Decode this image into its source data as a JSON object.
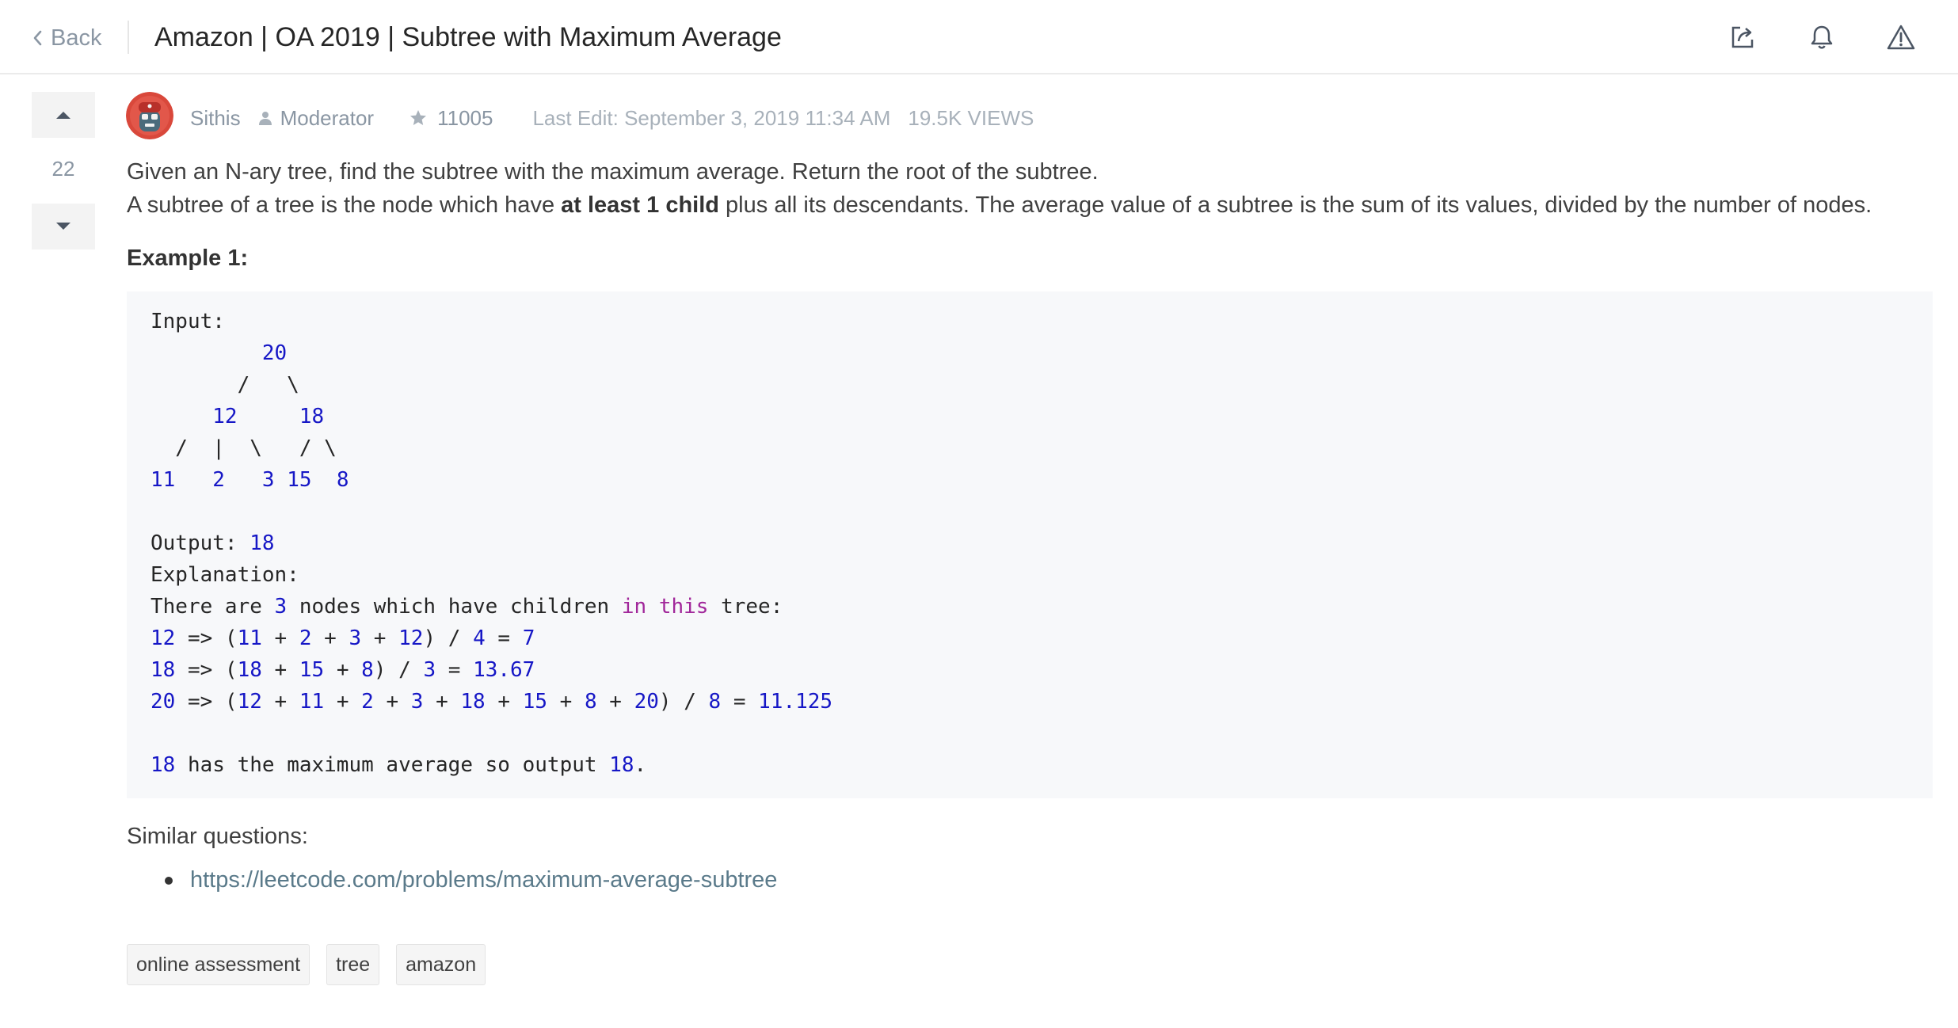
{
  "header": {
    "back_label": "Back",
    "title": "Amazon | OA 2019 | Subtree with Maximum Average",
    "icons": [
      "share-icon",
      "bell-icon",
      "warning-icon"
    ]
  },
  "vote": {
    "count": "22"
  },
  "author": {
    "username": "Sithis",
    "role": "Moderator",
    "reputation": "11005",
    "last_edit": "Last Edit: September 3, 2019 11:34 AM",
    "views": "19.5K VIEWS"
  },
  "post": {
    "line1": "Given an N-ary tree, find the subtree with the maximum average. Return the root of the subtree.",
    "line2_pre": "A subtree of a tree is the node which have ",
    "line2_bold": "at least 1 child",
    "line2_post": " plus all its descendants. The average value of a subtree is the sum of its values, divided by the number of nodes.",
    "example_heading": "Example 1:",
    "code_lines": [
      [
        {
          "t": "Input:"
        }
      ],
      [
        {
          "t": "         "
        },
        {
          "t": "20",
          "c": "num"
        }
      ],
      [
        {
          "t": "       /   \\"
        }
      ],
      [
        {
          "t": "     "
        },
        {
          "t": "12",
          "c": "num"
        },
        {
          "t": "     "
        },
        {
          "t": "18",
          "c": "num"
        }
      ],
      [
        {
          "t": "  /  |  \\   / \\"
        }
      ],
      [
        {
          "t": "11",
          "c": "num"
        },
        {
          "t": "   "
        },
        {
          "t": "2",
          "c": "num"
        },
        {
          "t": "   "
        },
        {
          "t": "3",
          "c": "num"
        },
        {
          "t": " "
        },
        {
          "t": "15",
          "c": "num"
        },
        {
          "t": "  "
        },
        {
          "t": "8",
          "c": "num"
        }
      ],
      [
        {
          "t": ""
        }
      ],
      [
        {
          "t": "Output: "
        },
        {
          "t": "18",
          "c": "num"
        }
      ],
      [
        {
          "t": "Explanation:"
        }
      ],
      [
        {
          "t": "There are "
        },
        {
          "t": "3",
          "c": "num"
        },
        {
          "t": " nodes which have children "
        },
        {
          "t": "in",
          "c": "kw"
        },
        {
          "t": " "
        },
        {
          "t": "this",
          "c": "kw"
        },
        {
          "t": " tree:"
        }
      ],
      [
        {
          "t": "12",
          "c": "num"
        },
        {
          "t": " => ("
        },
        {
          "t": "11",
          "c": "num"
        },
        {
          "t": " + "
        },
        {
          "t": "2",
          "c": "num"
        },
        {
          "t": " + "
        },
        {
          "t": "3",
          "c": "num"
        },
        {
          "t": " + "
        },
        {
          "t": "12",
          "c": "num"
        },
        {
          "t": ") / "
        },
        {
          "t": "4",
          "c": "num"
        },
        {
          "t": " = "
        },
        {
          "t": "7",
          "c": "num"
        }
      ],
      [
        {
          "t": "18",
          "c": "num"
        },
        {
          "t": " => ("
        },
        {
          "t": "18",
          "c": "num"
        },
        {
          "t": " + "
        },
        {
          "t": "15",
          "c": "num"
        },
        {
          "t": " + "
        },
        {
          "t": "8",
          "c": "num"
        },
        {
          "t": ") / "
        },
        {
          "t": "3",
          "c": "num"
        },
        {
          "t": " = "
        },
        {
          "t": "13.67",
          "c": "num"
        }
      ],
      [
        {
          "t": "20",
          "c": "num"
        },
        {
          "t": " => ("
        },
        {
          "t": "12",
          "c": "num"
        },
        {
          "t": " + "
        },
        {
          "t": "11",
          "c": "num"
        },
        {
          "t": " + "
        },
        {
          "t": "2",
          "c": "num"
        },
        {
          "t": " + "
        },
        {
          "t": "3",
          "c": "num"
        },
        {
          "t": " + "
        },
        {
          "t": "18",
          "c": "num"
        },
        {
          "t": " + "
        },
        {
          "t": "15",
          "c": "num"
        },
        {
          "t": " + "
        },
        {
          "t": "8",
          "c": "num"
        },
        {
          "t": " + "
        },
        {
          "t": "20",
          "c": "num"
        },
        {
          "t": ") / "
        },
        {
          "t": "8",
          "c": "num"
        },
        {
          "t": " = "
        },
        {
          "t": "11.125",
          "c": "num"
        }
      ],
      [
        {
          "t": ""
        }
      ],
      [
        {
          "t": "18",
          "c": "num"
        },
        {
          "t": " has the maximum average so output "
        },
        {
          "t": "18",
          "c": "num"
        },
        {
          "t": "."
        }
      ]
    ],
    "similar_heading": "Similar questions:",
    "similar_links": [
      "https://leetcode.com/problems/maximum-average-subtree"
    ]
  },
  "tags": [
    "online assessment",
    "tree",
    "amazon"
  ]
}
